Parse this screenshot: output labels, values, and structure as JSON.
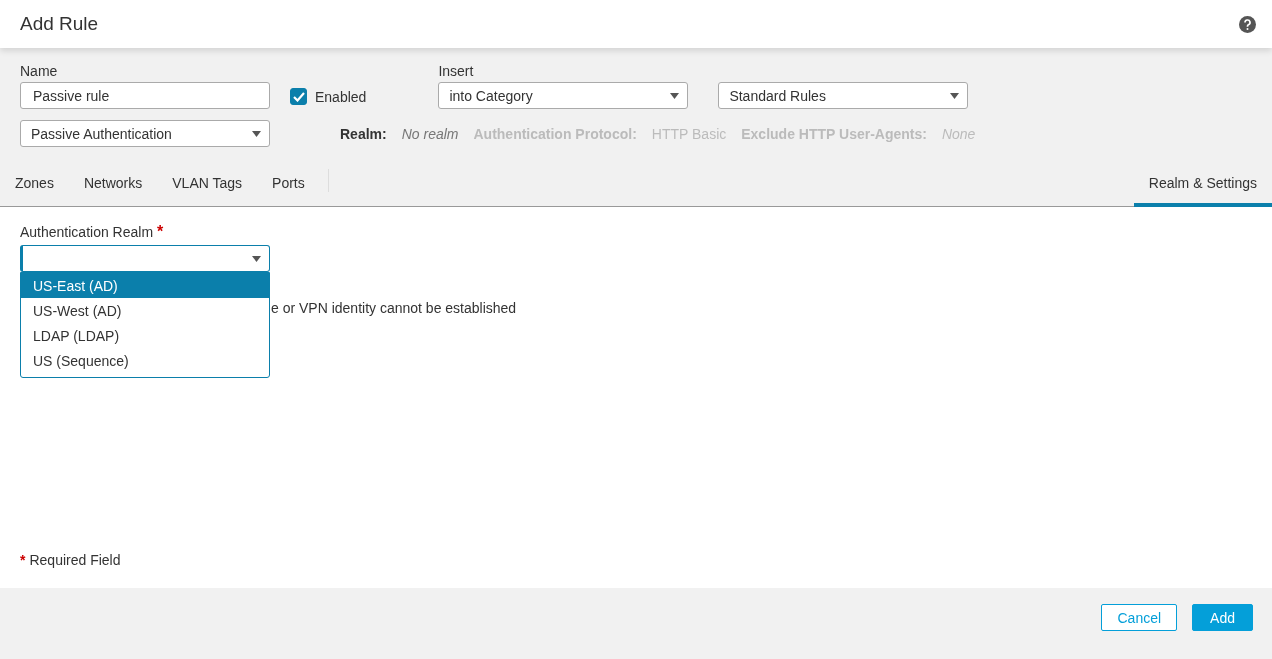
{
  "window": {
    "title": "Add Rule"
  },
  "name_field": {
    "label": "Name",
    "value": "Passive rule"
  },
  "enabled": {
    "label": "Enabled",
    "checked": true
  },
  "insert": {
    "label": "Insert",
    "value": "into Category"
  },
  "category": {
    "value": "Standard Rules"
  },
  "action": {
    "value": "Passive Authentication"
  },
  "summary": [
    {
      "label": "Realm:",
      "value": "No realm",
      "disabled": false
    },
    {
      "label": "Authentication Protocol:",
      "value": "HTTP Basic",
      "disabled": true
    },
    {
      "label": "Exclude HTTP User-Agents:",
      "value": "None",
      "disabled": true
    }
  ],
  "tabs": [
    {
      "label": "Zones",
      "selected": false
    },
    {
      "label": "Networks",
      "selected": false
    },
    {
      "label": "VLAN Tags",
      "selected": false
    },
    {
      "label": "Ports",
      "selected": false
    },
    {
      "label": "Realm & Settings",
      "selected": true
    }
  ],
  "realm_field": {
    "label": "Authentication Realm",
    "required_mark": "*",
    "options": [
      {
        "label": "US-East (AD)",
        "selected": true
      },
      {
        "label": "US-West (AD)",
        "selected": false
      },
      {
        "label": "LDAP (LDAP)",
        "selected": false
      },
      {
        "label": "US (Sequence)",
        "selected": false
      }
    ]
  },
  "hidden_option_text": "e or VPN identity cannot be established",
  "required_note": {
    "mark": "*",
    "text": "Required Field"
  },
  "buttons": [
    {
      "label": "Cancel",
      "kind": "secondary"
    },
    {
      "label": "Add",
      "kind": "primary"
    }
  ]
}
